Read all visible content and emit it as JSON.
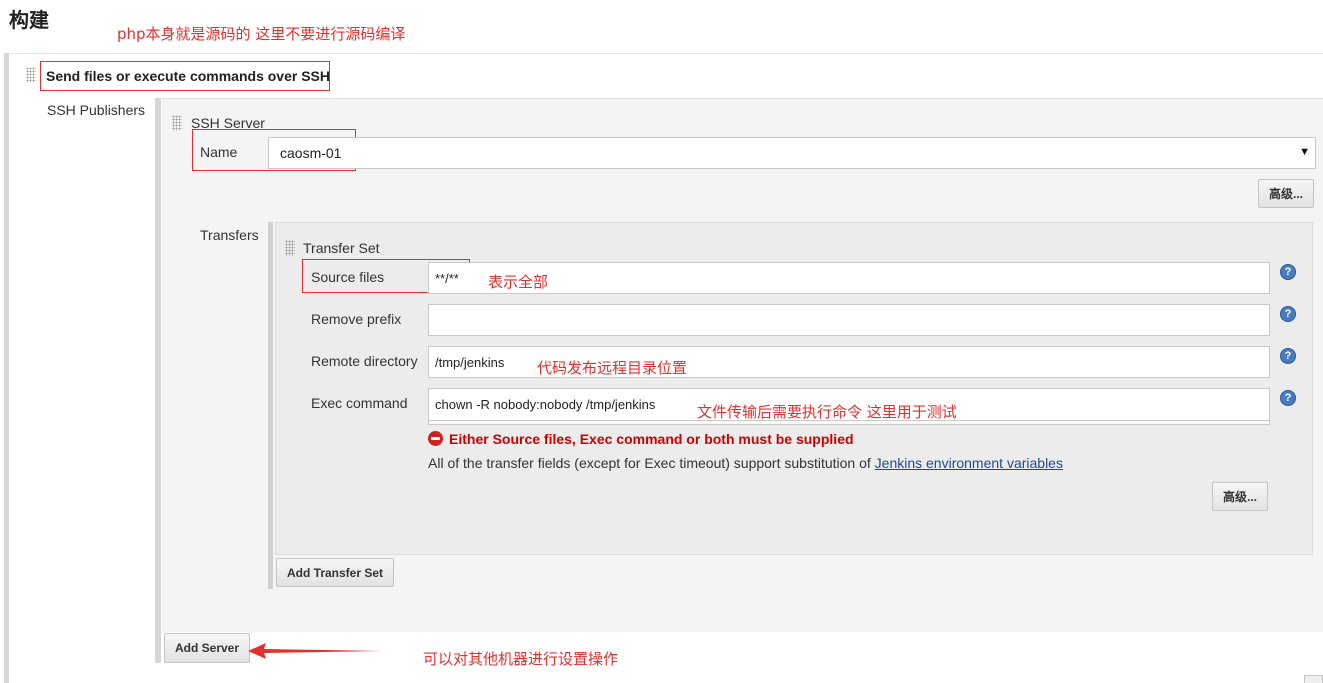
{
  "page": {
    "title": "构建"
  },
  "annotations": {
    "php_note": "php本身就是源码的 这里不要进行源码编译",
    "source_all": "表示全部",
    "remote_dir_note": "代码发布远程目录位置",
    "exec_note": "文件传输后需要执行命令 这里用于测试",
    "add_server_note": "可以对其他机器进行设置操作"
  },
  "builder": {
    "title": "Send files or execute commands over SSH",
    "publishers_label": "SSH Publishers",
    "server": {
      "section_label": "SSH Server",
      "name_label": "Name",
      "name_value": "caosm-01",
      "advanced_button": "高级...",
      "transfers_label": "Transfers",
      "transfer_set": {
        "section_label": "Transfer Set",
        "source_files_label": "Source files",
        "source_files_value": "**/**",
        "remove_prefix_label": "Remove prefix",
        "remove_prefix_value": "",
        "remote_directory_label": "Remote directory",
        "remote_directory_value": "/tmp/jenkins",
        "exec_command_label": "Exec command",
        "exec_command_value": "chown -R nobody:nobody /tmp/jenkins",
        "error_message": "Either Source files, Exec command or both must be supplied",
        "info_text": "All of the transfer fields (except for Exec timeout) support substitution of ",
        "info_link": "Jenkins environment variables",
        "advanced_button": "高级..."
      },
      "add_transfer_set_button": "Add Transfer Set"
    },
    "add_server_button": "Add Server"
  },
  "icons": {
    "help": "help-icon",
    "error": "error-icon",
    "dropdown": "chevron-down-icon",
    "drag": "drag-handle-icon"
  },
  "colors": {
    "annotation_red": "#e0312f",
    "error_red": "#cc0000",
    "link": "#204a87"
  }
}
